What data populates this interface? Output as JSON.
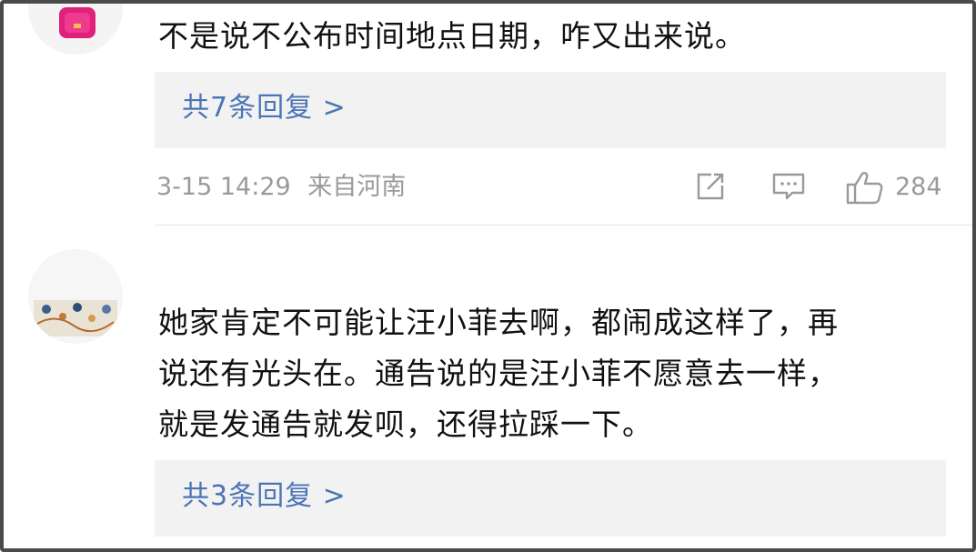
{
  "comments": [
    {
      "text": "不是说不公布时间地点日期，咋又出来说。",
      "reply_link": "共7条回复 >",
      "meta": {
        "date": "3-15 14:29",
        "source": "来自河南"
      },
      "likes": "284"
    },
    {
      "lines": [
        "她家肯定不可能让汪小菲去啊，都闹成这样了，再",
        "说还有光头在。通告说的是汪小菲不愿意去一样，",
        "就是发通告就发呗，还得拉踩一下。"
      ],
      "reply_link": "共3条回复 >"
    }
  ],
  "icons": {
    "share": "share-icon",
    "comment": "comment-icon",
    "like": "thumbs-up-icon"
  },
  "colors": {
    "link": "#4b75b6",
    "meta": "#9a9a9a",
    "reply_bg": "#f2f2f2",
    "text": "#111111"
  }
}
